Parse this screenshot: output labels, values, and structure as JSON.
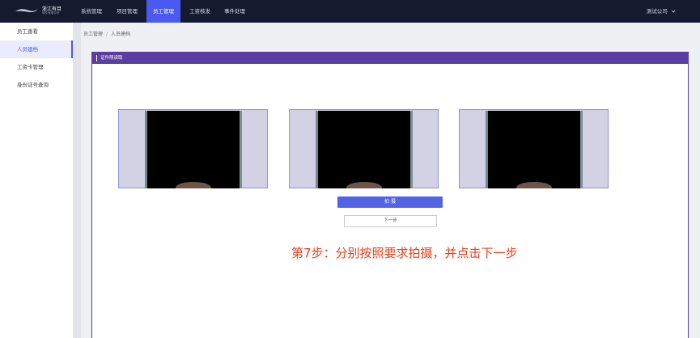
{
  "header": {
    "logo_name": "浙江有目",
    "logo_sub": "软件有限公司",
    "nav": [
      {
        "label": "系统管理",
        "active": false
      },
      {
        "label": "项目管理",
        "active": false
      },
      {
        "label": "员工管理",
        "active": true
      },
      {
        "label": "工资核发",
        "active": false
      },
      {
        "label": "事件处理",
        "active": false
      }
    ],
    "company": "测试公司",
    "company_icon": "chevron-down-icon"
  },
  "sidebar": {
    "items": [
      {
        "label": "员工查看",
        "active": false
      },
      {
        "label": "人员建档",
        "active": true
      },
      {
        "label": "工资卡管理",
        "active": false
      },
      {
        "label": "身份证号查询",
        "active": false
      }
    ]
  },
  "breadcrumb": {
    "items": [
      "员工管理",
      "人员建档"
    ],
    "separator": "/"
  },
  "panel": {
    "title": "证件照读取",
    "shoot_button": "拍 摄",
    "next_button": "下一步",
    "instruction": "第7步：分别按照要求拍摄，并点击下一步"
  },
  "colors": {
    "topbar": "#161a2f",
    "accent": "#4a5af0",
    "panel_header": "#5a3fa0",
    "instruction": "#e8401d"
  }
}
